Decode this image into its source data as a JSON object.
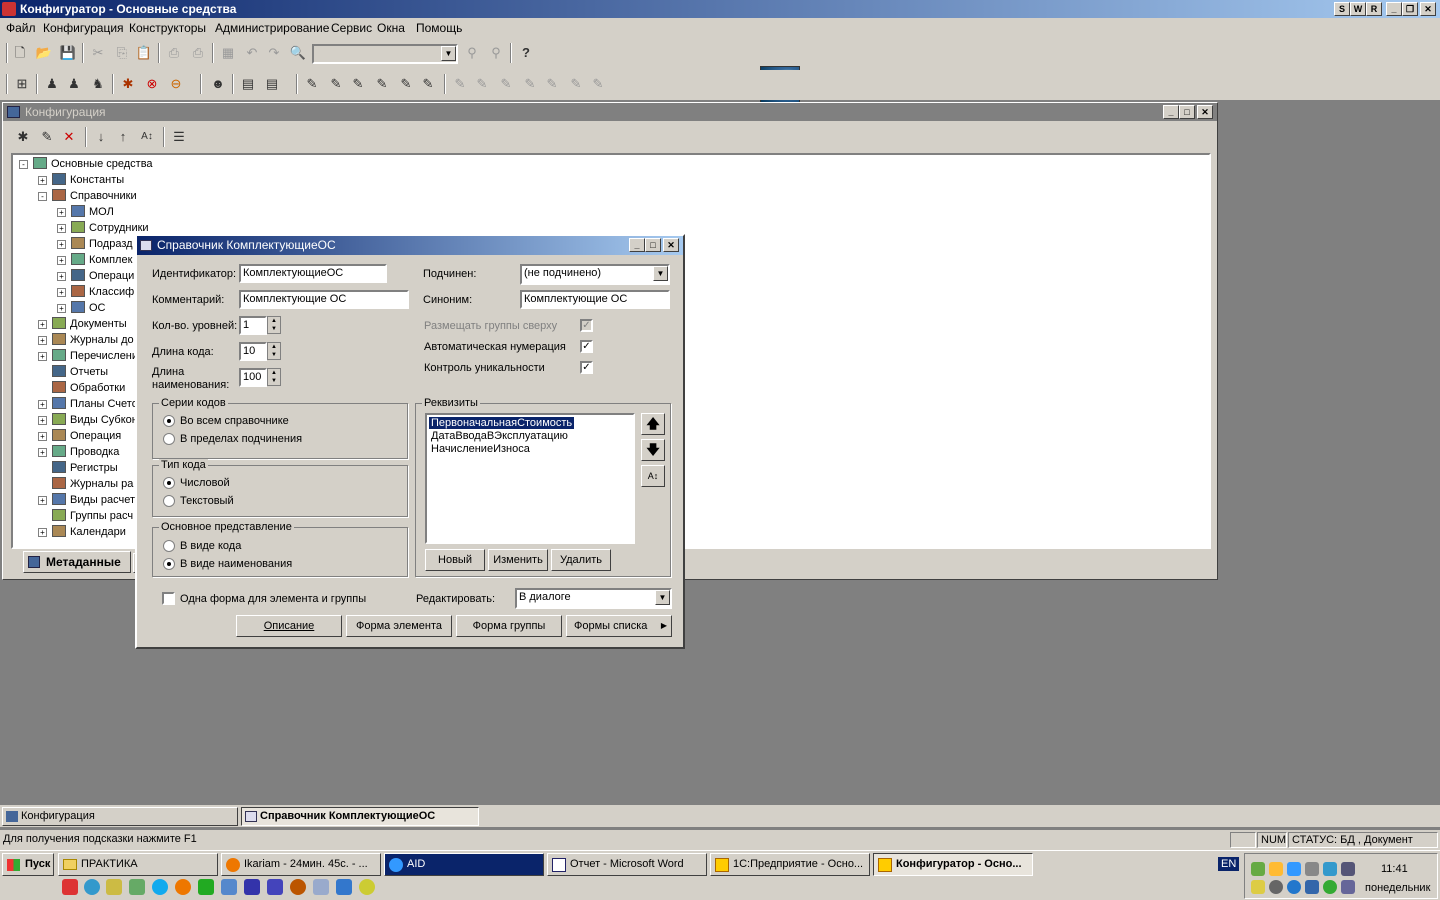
{
  "app": {
    "title": "Конфигуратор - Основные средства",
    "winbtns": [
      "S",
      "W",
      "R"
    ]
  },
  "menu": [
    "Файл",
    "Конфигурация",
    "Конструкторы",
    "Администрирование",
    "Сервис",
    "Окна",
    "Помощь"
  ],
  "config_window": {
    "title": "Конфигурация",
    "tree": [
      {
        "label": "Основные средства",
        "level": 0,
        "pm": "-"
      },
      {
        "label": "Константы",
        "level": 1,
        "pm": "+"
      },
      {
        "label": "Справочники",
        "level": 1,
        "pm": "-"
      },
      {
        "label": "МОЛ",
        "level": 2,
        "pm": "+"
      },
      {
        "label": "Сотрудники",
        "level": 2,
        "pm": "+"
      },
      {
        "label": "Подразд",
        "level": 2,
        "pm": "+"
      },
      {
        "label": "Комплек",
        "level": 2,
        "pm": "+"
      },
      {
        "label": "Операци",
        "level": 2,
        "pm": "+"
      },
      {
        "label": "Классиф",
        "level": 2,
        "pm": "+"
      },
      {
        "label": "ОС",
        "level": 2,
        "pm": "+"
      },
      {
        "label": "Документы",
        "level": 1,
        "pm": "+"
      },
      {
        "label": "Журналы до",
        "level": 1,
        "pm": "+"
      },
      {
        "label": "Перечислени",
        "level": 1,
        "pm": "+"
      },
      {
        "label": "Отчеты",
        "level": 1,
        "pm": ""
      },
      {
        "label": "Обработки",
        "level": 1,
        "pm": ""
      },
      {
        "label": "Планы Счето",
        "level": 1,
        "pm": "+"
      },
      {
        "label": "Виды Субкон",
        "level": 1,
        "pm": "+"
      },
      {
        "label": "Операция",
        "level": 1,
        "pm": "+"
      },
      {
        "label": "Проводка",
        "level": 1,
        "pm": "+"
      },
      {
        "label": "Регистры",
        "level": 1,
        "pm": ""
      },
      {
        "label": "Журналы ра",
        "level": 1,
        "pm": ""
      },
      {
        "label": "Виды расчет",
        "level": 1,
        "pm": "+"
      },
      {
        "label": "Группы расч",
        "level": 1,
        "pm": ""
      },
      {
        "label": "Календари",
        "level": 1,
        "pm": "+"
      }
    ],
    "tab_metadata": "Метаданные"
  },
  "dialog": {
    "title": "Справочник КомплектующиеОС",
    "identifier_label": "Идентификатор:",
    "identifier_value": "КомплектующиеОС",
    "comment_label": "Комментарий:",
    "comment_value": "Комплектующие ОС",
    "levels_label": "Кол-во. уровней:",
    "levels_value": "1",
    "code_len_label": "Длина кода:",
    "code_len_value": "10",
    "name_len_label": "Длина наименования:",
    "name_len_value": "100",
    "subordinate_label": "Подчинен:",
    "subordinate_value": "(не подчинено)",
    "synonym_label": "Синоним:",
    "synonym_value": "Комплектующие ОС",
    "groups_on_top": "Размещать группы сверху",
    "auto_numbering": "Автоматическая нумерация",
    "uniqueness": "Контроль уникальности",
    "code_series_title": "Серии кодов",
    "code_series_opt1": "Во всем справочнике",
    "code_series_opt2": "В пределах подчинения",
    "code_type_title": "Тип кода",
    "code_type_opt1": "Числовой",
    "code_type_opt2": "Текстовый",
    "main_repr_title": "Основное представление",
    "main_repr_opt1": "В виде кода",
    "main_repr_opt2": "В виде наименования",
    "attributes_title": "Реквизиты",
    "attributes": [
      "ПервоначальнаяСтоимость",
      "ДатаВводаВЭксплуатацию",
      "НачислениеИзноса"
    ],
    "btn_new": "Новый",
    "btn_edit": "Изменить",
    "btn_delete": "Удалить",
    "one_form": "Одна форма для элемента и группы",
    "edit_label": "Редактировать:",
    "edit_value": "В диалоге",
    "btn_description": "Описание",
    "btn_element_form": "Форма элемента",
    "btn_group_form": "Форма группы",
    "btn_list_forms": "Формы списка"
  },
  "mdi_tabs": [
    "Конфигурация",
    "Справочник КомплектующиеОС"
  ],
  "status": {
    "hint": "Для получения подсказки нажмите F1",
    "num": "NUM",
    "state": "СТАТУС: БД , Документ"
  },
  "taskbar": {
    "start": "Пуск",
    "items": [
      "ПРАКТИКА",
      "Ikariam - 24мин. 45с. - ...",
      "AID",
      "Отчет - Microsoft Word",
      "1С:Предприятие - Осно...",
      "Конфигуратор - Осно..."
    ],
    "lang": "EN",
    "time": "11:41",
    "day": "понедельник"
  }
}
